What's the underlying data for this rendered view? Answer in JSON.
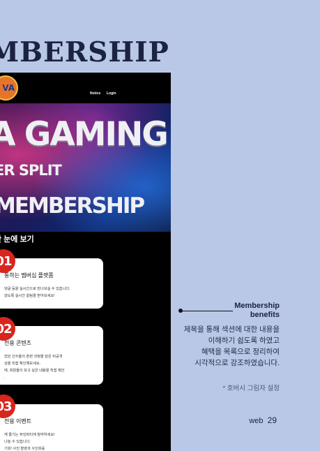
{
  "page_title": "MBERSHIP",
  "mockup": {
    "logo_text": "VA",
    "nav": {
      "notice": "Notice",
      "login": "Login"
    },
    "hero": {
      "line1": "A GAMING",
      "line2": "ER SPLIT",
      "line3": "MEMBERSHIP"
    },
    "section_heading": "한 눈에 보기",
    "cards": [
      {
        "badge": "01",
        "title": "통하는 멤버십 플랫폼",
        "desc": [
          "댓글 등을 실시간으로 만나보실 수 있습니다.",
          "않도록 실시간 알림을 받아보세요!"
        ]
      },
      {
        "badge": "02",
        "title": "전용 콘텐츠",
        "desc": [
          "었던 선수들의 훈련 과정을 담은 비공개",
          "상을 직접 확인해보세요.",
          "에, 회원들이 보고 싶은 내용을 직접 제안",
          "."
        ]
      },
      {
        "badge": "03",
        "title": "전용 이벤트",
        "desc": [
          "께 즐기는 뷰잉파티에 참여하세요!",
          "나눌 수 있습니다.",
          "기회! 사진 촬영과 사인회를"
        ]
      }
    ]
  },
  "side": {
    "title_lines": [
      "Membership",
      "benefits"
    ],
    "desc_lines": [
      "제목을 통해 섹션에 대한 내용을",
      "이해하기 쉽도록 하였고",
      "혜택을 목록으로 정리하여",
      "시각적으로 강조하였습니다."
    ],
    "credit": "* 호버시 그림자 설정"
  },
  "footer": {
    "section": "web",
    "page": "29"
  },
  "colors": {
    "background": "#b8c8e6",
    "title": "#1b2340",
    "badge": "#d8251e"
  }
}
